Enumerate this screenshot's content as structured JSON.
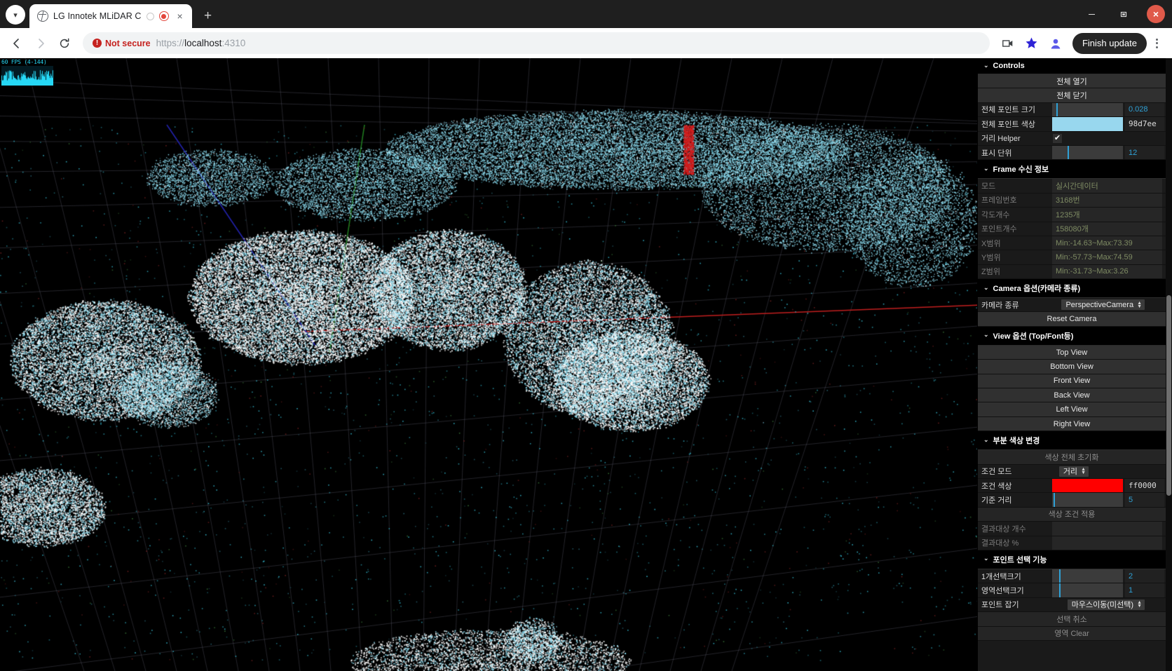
{
  "browser": {
    "tab": {
      "title": "LG Innotek MLiDAR C",
      "favicon": "globe-icon",
      "loading_spinner": "spinner-icon",
      "recording_indicator": "record-dot-icon",
      "close": "×"
    },
    "new_tab": "+",
    "tab_list_chevron": "▾",
    "window": {
      "minimize": "–",
      "maximize": "❐",
      "close": "×"
    },
    "nav": {
      "back": "←",
      "forward": "→",
      "reload": "↻"
    },
    "security_label": "Not secure",
    "security_icon": "!",
    "url": {
      "scheme": "https://",
      "host": "localhost",
      "port": ":4310",
      "full": "https://localhost:4310"
    },
    "actions": {
      "cast_icon": "cast-icon",
      "bookmark_icon": "star-icon",
      "profile_icon": "profile-avatar-icon",
      "finish_update": "Finish update",
      "menu_icon": "kebab-menu-icon"
    }
  },
  "overlay": {
    "fps_text": "60 FPS (4-144)",
    "fps_color": "#26d7f5"
  },
  "scene": {
    "background": "#000000",
    "point_color_primary": "#8cdcf0",
    "point_color_hot": "#ffffff",
    "axis_x_color": "#c21f1f",
    "axis_y_color": "#1f7a1f",
    "axis_z_color": "#2222aa",
    "grid_color": "#4a4a55"
  },
  "gui": {
    "folders": [
      {
        "id": "controls",
        "title": "Controls",
        "chevron": "⌄",
        "buttons": [
          {
            "label": "전체 열기",
            "name": "open-all-button"
          },
          {
            "label": "전체 닫기",
            "name": "close-all-button"
          }
        ],
        "rows": [
          {
            "type": "slider",
            "label": "전체 포인트 크기",
            "value": "0.028",
            "fill_pct": 6,
            "name": "global-point-size"
          },
          {
            "type": "color",
            "label": "전체 포인트 색상",
            "value": "98d7ee",
            "color": "#98d7ee",
            "name": "global-point-color"
          },
          {
            "type": "checkbox",
            "label": "거리 Helper",
            "checked": true,
            "name": "distance-helper-toggle"
          },
          {
            "type": "slider",
            "label": "표시 단위",
            "value": "12",
            "fill_pct": 22,
            "name": "display-unit"
          }
        ]
      },
      {
        "id": "frame-info",
        "title": "Frame 수신 정보",
        "chevron": "⌄",
        "readonly_rows": [
          {
            "label": "모드",
            "value": "실시간데이터",
            "name": "frame-mode"
          },
          {
            "label": "프레임번호",
            "value": "3168번",
            "name": "frame-number"
          },
          {
            "label": "각도개수",
            "value": "1235개",
            "name": "angle-count"
          },
          {
            "label": "포인트개수",
            "value": "158080개",
            "name": "point-count"
          },
          {
            "label": "X범위",
            "value": "Min:-14.63~Max:73.39",
            "name": "x-range"
          },
          {
            "label": "Y범위",
            "value": "Min:-57.73~Max:74.59",
            "name": "y-range"
          },
          {
            "label": "Z범위",
            "value": "Min:-31.73~Max:3.26",
            "name": "z-range"
          }
        ]
      },
      {
        "id": "camera-options",
        "title": "Camera 옵션(카메라 종류)",
        "chevron": "⌄",
        "select_row": {
          "label": "카메라 종류",
          "value": "PerspectiveCamera",
          "name": "camera-type-select"
        },
        "buttons": [
          {
            "label": "Reset Camera",
            "name": "reset-camera-button"
          }
        ]
      },
      {
        "id": "view-options",
        "title": "View 옵션 (Top/Font등)",
        "chevron": "⌄",
        "buttons": [
          {
            "label": "Top View",
            "name": "top-view-button"
          },
          {
            "label": "Bottom View",
            "name": "bottom-view-button"
          },
          {
            "label": "Front View",
            "name": "front-view-button"
          },
          {
            "label": "Back View",
            "name": "back-view-button"
          },
          {
            "label": "Left View",
            "name": "left-view-button"
          },
          {
            "label": "Right View",
            "name": "right-view-button"
          }
        ]
      },
      {
        "id": "partial-color",
        "title": "부분 색상 변경",
        "chevron": "⌄",
        "reset_button": {
          "label": "색상 전체 초기화",
          "name": "reset-all-colors-button"
        },
        "condition_mode": {
          "label": "조건 모드",
          "value": "거리",
          "name": "condition-mode-select"
        },
        "condition_color": {
          "label": "조건 색상",
          "value": "ff0000",
          "color": "#ff0000",
          "name": "condition-color"
        },
        "base_distance": {
          "label": "기준 거리",
          "value": "5",
          "fill_pct": 2,
          "name": "base-distance-slider"
        },
        "apply_button": {
          "label": "색상 조건 적용",
          "name": "apply-color-condition-button"
        },
        "results": [
          {
            "label": "결과대상 개수",
            "value": "",
            "name": "result-count"
          },
          {
            "label": "결과대상 %",
            "value": "",
            "name": "result-percent"
          }
        ]
      },
      {
        "id": "point-select",
        "title": "포인트 선택 기능",
        "chevron": "⌄",
        "rows": [
          {
            "type": "slider",
            "label": "1개선택크기",
            "value": "2",
            "fill_pct": 10,
            "name": "single-select-size"
          },
          {
            "type": "slider",
            "label": "영역선택크기",
            "value": "1",
            "fill_pct": 10,
            "name": "area-select-size"
          }
        ],
        "grab_mode": {
          "label": "포인트 잡기",
          "value": "마우스이동(미선택)",
          "name": "point-grab-mode-select"
        },
        "buttons": [
          {
            "label": "선택 취소",
            "name": "cancel-selection-button"
          },
          {
            "label": "영역 Clear",
            "name": "area-clear-button"
          }
        ]
      }
    ]
  }
}
